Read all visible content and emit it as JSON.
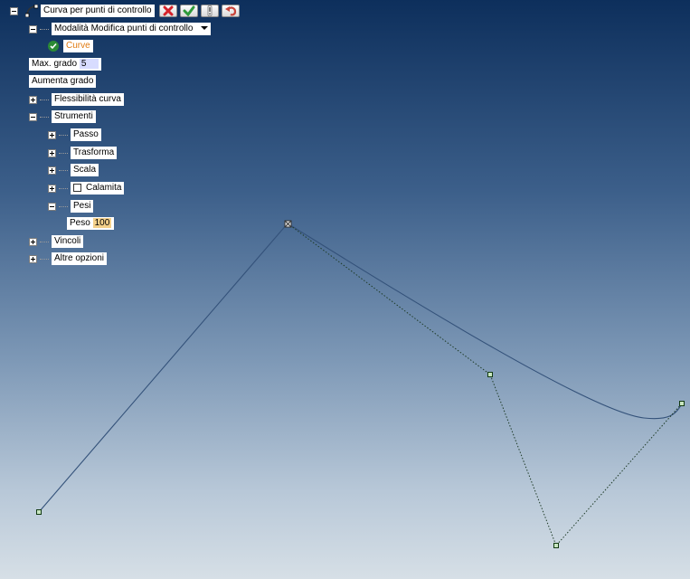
{
  "tree": {
    "root_label": "Curva per punti di controllo",
    "mode_label": "Modalità",
    "mode_value": "Modifica punti di controllo",
    "curve_label": "Curve",
    "max_grade_label": "Max. grado",
    "max_grade_value": "5",
    "increase_grade_label": "Aumenta grado",
    "flexibility_label": "Flessibilità curva",
    "tools_label": "Strumenti",
    "step_label": "Passo",
    "transform_label": "Trasforma",
    "scale_label": "Scala",
    "magnet_label": "Calamita",
    "weights_label": "Pesi",
    "weight_label": "Peso",
    "weight_value": "100",
    "constraints_label": "Vincoli",
    "other_options_label": "Altre opzioni"
  },
  "toolbar": {
    "cancel_icon": "red-x-icon",
    "ok_icon": "green-check-icon",
    "info_icon": "exclamation-icon",
    "undo_icon": "undo-arrow-icon"
  },
  "colors": {
    "curve_label": "#e07b12",
    "max_grade_bg": "#d8dcff",
    "weight_value_bg": "#f4d08a",
    "curve_line": "#34527a",
    "control_polygon": "#1f3c28",
    "control_point": "#3f8a3a"
  }
}
